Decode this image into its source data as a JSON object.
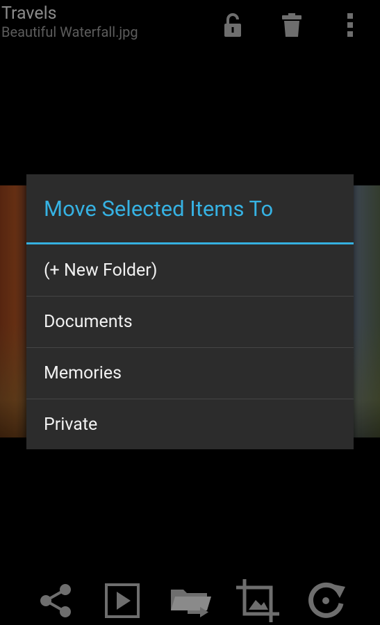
{
  "actionbar": {
    "title": "Travels",
    "subtitle": "Beautiful Waterfall.jpg",
    "icons": [
      "unlock-icon",
      "trash-icon",
      "overflow-menu-icon"
    ]
  },
  "dialog": {
    "title": "Move Selected Items To",
    "items": [
      {
        "label": "(+ New Folder)"
      },
      {
        "label": "Documents"
      },
      {
        "label": "Memories"
      },
      {
        "label": "Private"
      }
    ],
    "accent_color": "#36B2E3"
  },
  "bottombar": {
    "icons": [
      "share-icon",
      "slideshow-icon",
      "move-to-folder-icon",
      "crop-icon",
      "rotate-icon"
    ]
  },
  "colors": {
    "background": "#000000",
    "dialog_background": "#2C2C2C",
    "icon_gray": "#6E6E6E"
  }
}
